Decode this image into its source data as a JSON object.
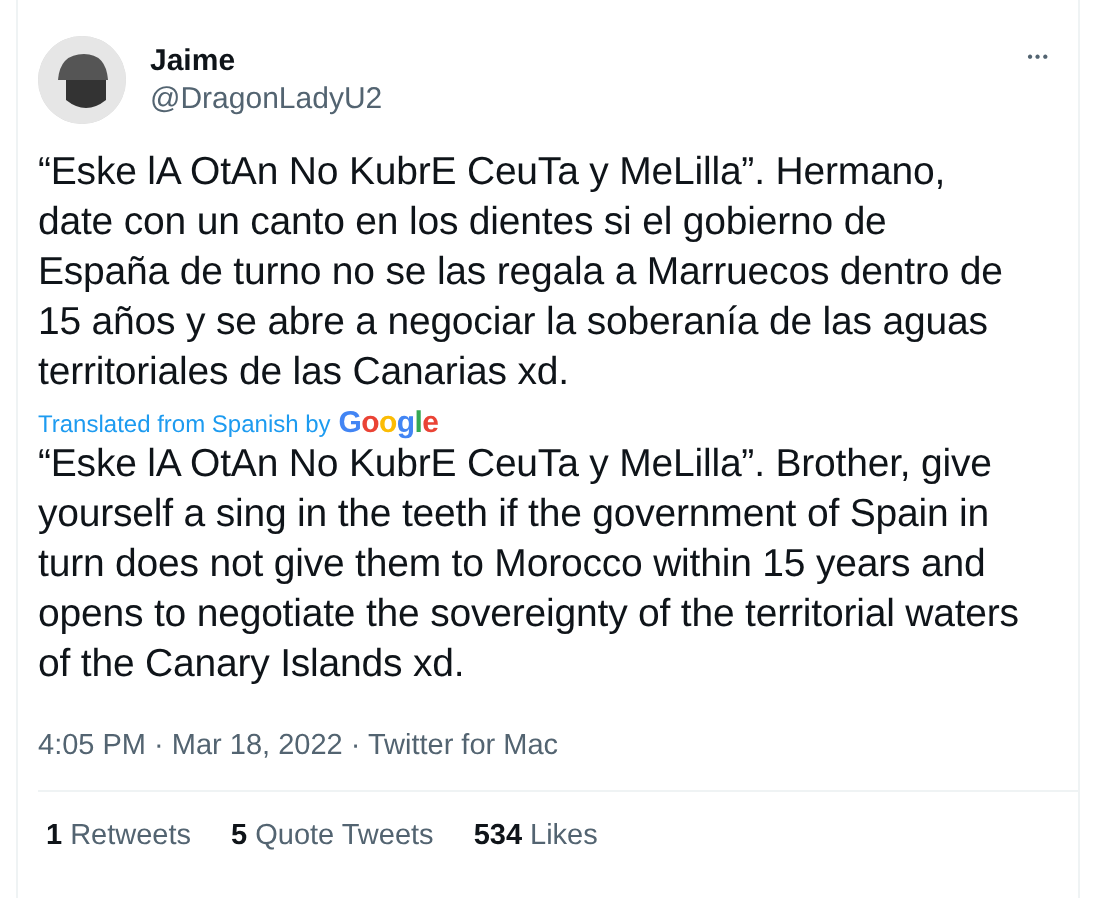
{
  "author": {
    "name": "Jaime",
    "handle": "@DragonLadyU2"
  },
  "more_button": "•••",
  "tweet_text": "“Eske lA OtAn No KubrE CeuTa y MeLilla”. Hermano, date con un canto en los dientes si el gobierno de España de turno no se las regala a Marruecos dentro de 15 años y se abre a negociar la soberanía de las aguas territoriales de las Canarias xd.",
  "translation": {
    "label": "Translated from Spanish by",
    "brand": [
      {
        "letter": "G",
        "color": "#4285f4"
      },
      {
        "letter": "o",
        "color": "#ea4335"
      },
      {
        "letter": "o",
        "color": "#fbbc05"
      },
      {
        "letter": "g",
        "color": "#4285f4"
      },
      {
        "letter": "l",
        "color": "#34a853"
      },
      {
        "letter": "e",
        "color": "#ea4335"
      }
    ],
    "text": "“Eske lA OtAn No KubrE CeuTa y MeLilla”. Brother, give yourself a sing in the teeth if the government of Spain in turn does not give them to Morocco within 15 years and opens to negotiate the sovereignty of the territorial waters of the Canary Islands xd."
  },
  "timestamp": "4:05 PM · Mar 18, 2022 · Twitter for Mac",
  "stats": [
    {
      "count": "1",
      "label": "Retweets"
    },
    {
      "count": "5",
      "label": "Quote Tweets"
    },
    {
      "count": "534",
      "label": "Likes"
    }
  ]
}
